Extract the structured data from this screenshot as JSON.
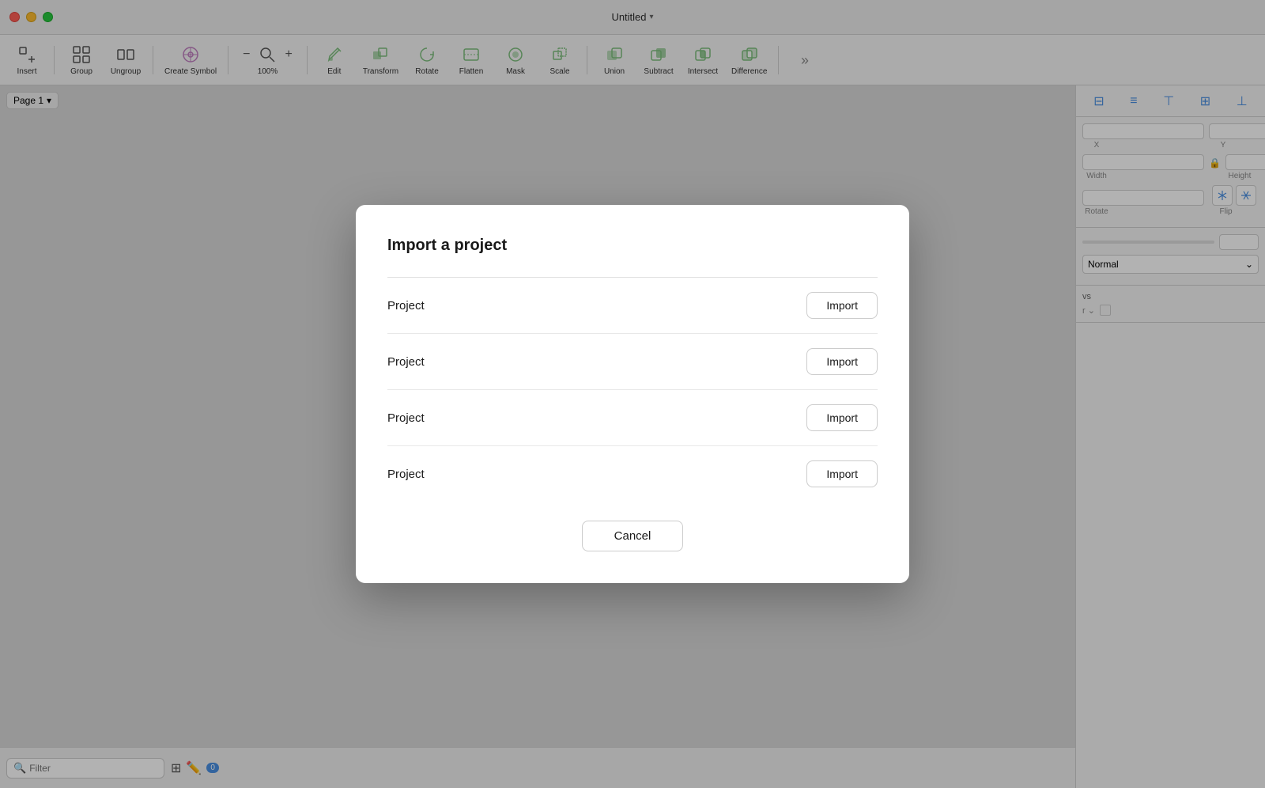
{
  "titlebar": {
    "title": "Untitled",
    "chevron": "▾"
  },
  "toolbar": {
    "insert_label": "Insert",
    "group_label": "Group",
    "ungroup_label": "Ungroup",
    "create_symbol_label": "Create Symbol",
    "zoom_minus": "−",
    "zoom_value": "100%",
    "zoom_plus": "+",
    "edit_label": "Edit",
    "transform_label": "Transform",
    "rotate_label": "Rotate",
    "flatten_label": "Flatten",
    "mask_label": "Mask",
    "scale_label": "Scale",
    "union_label": "Union",
    "subtract_label": "Subtract",
    "intersect_label": "Intersect",
    "difference_label": "Difference",
    "more_label": "›"
  },
  "page_selector": {
    "label": "Page 1",
    "chevron": "▾"
  },
  "right_panel": {
    "x_label": "X",
    "y_label": "Y",
    "width_label": "Width",
    "height_label": "Height",
    "rotate_label": "Rotate",
    "flip_label": "Flip",
    "blend_mode": "Normal",
    "opacity_value": ""
  },
  "bottom_bar": {
    "search_placeholder": "Filter",
    "badge_count": "0"
  },
  "modal": {
    "title": "Import a project",
    "projects": [
      {
        "name": "Project",
        "button": "Import"
      },
      {
        "name": "Project",
        "button": "Import"
      },
      {
        "name": "Project",
        "button": "Import"
      },
      {
        "name": "Project",
        "button": "Import"
      }
    ],
    "cancel_label": "Cancel"
  }
}
